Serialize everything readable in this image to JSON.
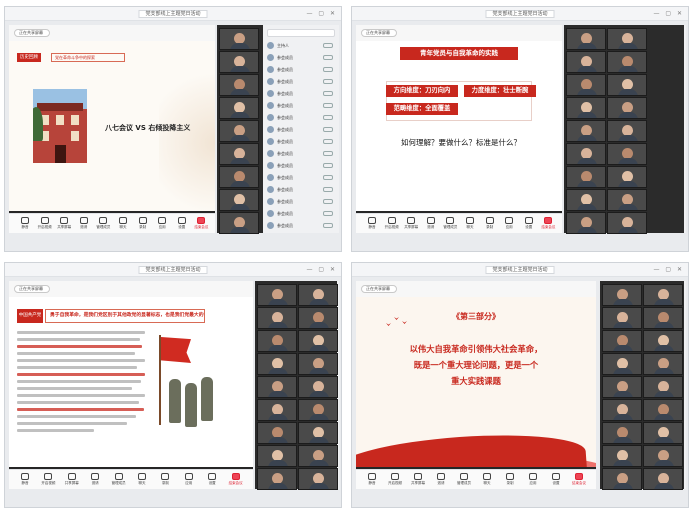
{
  "app": {
    "window_title": "党支部线上主题党日活动",
    "share_chip": "正在共享屏幕"
  },
  "toolbar": [
    "静音",
    "开启视频",
    "共享屏幕",
    "邀请",
    "管理成员",
    "聊天",
    "录制",
    "应用",
    "设置",
    "结束会议"
  ],
  "participants": [
    "主持人",
    "参会成员",
    "参会成员",
    "参会成员",
    "参会成员",
    "参会成员",
    "参会成员",
    "参会成员",
    "参会成员",
    "参会成员",
    "参会成员",
    "参会成员",
    "参会成员",
    "参会成员",
    "参会成员",
    "参会成员"
  ],
  "slides": {
    "s1": {
      "tag": "历史回顾",
      "subtitle": "党在革命斗争中的探索",
      "heading": "八七会议 VS 右倾投降主义"
    },
    "s2": {
      "title": "青年党员与自我革命的实践",
      "box1": "方向维度：刀刃向内",
      "box2": "力度维度：壮士断腕",
      "box3": "范畴维度：全面覆盖",
      "question": "如何理解？要做什么？标准是什么？"
    },
    "s3": {
      "tag": "中国共产党",
      "heading": "勇于自我革命，是我们党区别于其他政党的显著标志，也是我们党最大的优势"
    },
    "s4": {
      "part": "《第三部分》",
      "line1": "以伟大自我革命引领伟大社会革命，",
      "line2": "既是一个重大理论问题，更是一个",
      "line3": "重大实践课题"
    }
  },
  "colors": {
    "accent": "#c8281e",
    "bg": "#fdfaf5"
  }
}
